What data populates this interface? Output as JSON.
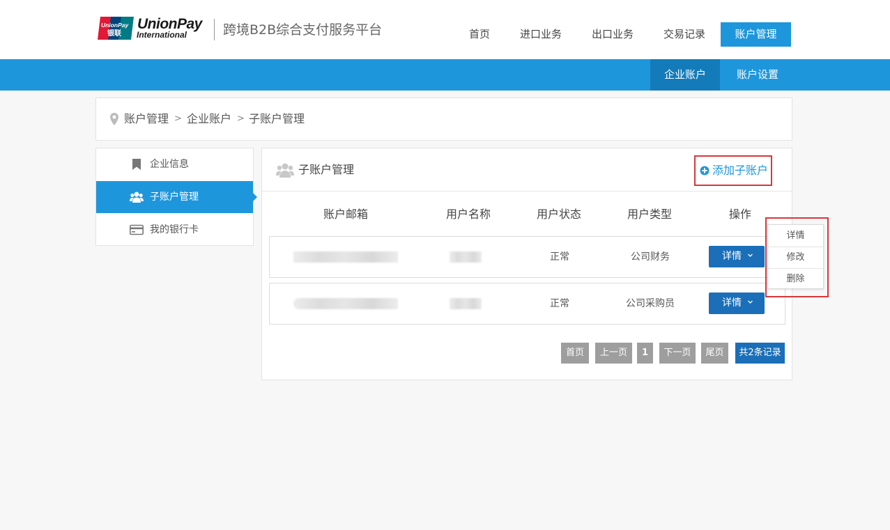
{
  "header": {
    "logo": {
      "brand_en": "UnionPay",
      "brand_sub": "International",
      "badge_en": "UnionPay",
      "badge_cn": "银联"
    },
    "platform_title": "跨境B2B综合支付服务平台",
    "nav": [
      {
        "label": "首页",
        "active": false
      },
      {
        "label": "进口业务",
        "active": false
      },
      {
        "label": "出口业务",
        "active": false
      },
      {
        "label": "交易记录",
        "active": false
      },
      {
        "label": "账户管理",
        "active": true
      }
    ]
  },
  "subnav": [
    {
      "label": "企业账户",
      "active": true
    },
    {
      "label": "账户设置",
      "active": false
    }
  ],
  "breadcrumb": {
    "icon": "location-pin-icon",
    "items": [
      "账户管理",
      "企业账户",
      "子账户管理"
    ],
    "separator": ">"
  },
  "sidebar": {
    "items": [
      {
        "label": "企业信息",
        "icon": "bookmark-icon",
        "active": false
      },
      {
        "label": "子账户管理",
        "icon": "users-icon",
        "active": true
      },
      {
        "label": "我的银行卡",
        "icon": "credit-card-icon",
        "active": false
      }
    ]
  },
  "main": {
    "title": "子账户管理",
    "title_icon": "users-icon",
    "add_button": "添加子账户",
    "columns": [
      "账户邮箱",
      "用户名称",
      "用户状态",
      "用户类型",
      "操作"
    ],
    "rows": [
      {
        "status": "正常",
        "type": "公司财务",
        "action": "详情"
      },
      {
        "status": "正常",
        "type": "公司采购员",
        "action": "详情"
      }
    ],
    "pagination": {
      "first": "首页",
      "prev": "上一页",
      "current": "1",
      "next": "下一页",
      "last": "尾页",
      "total": "共2条记录"
    }
  },
  "dropdown": {
    "items": [
      "详情",
      "修改",
      "删除"
    ]
  },
  "colors": {
    "primary": "#1e96dc",
    "primary_dark": "#137bb9",
    "button_blue": "#1a6fb8",
    "highlight_red": "#d9363a",
    "pager_gray": "#9e9e9e"
  }
}
